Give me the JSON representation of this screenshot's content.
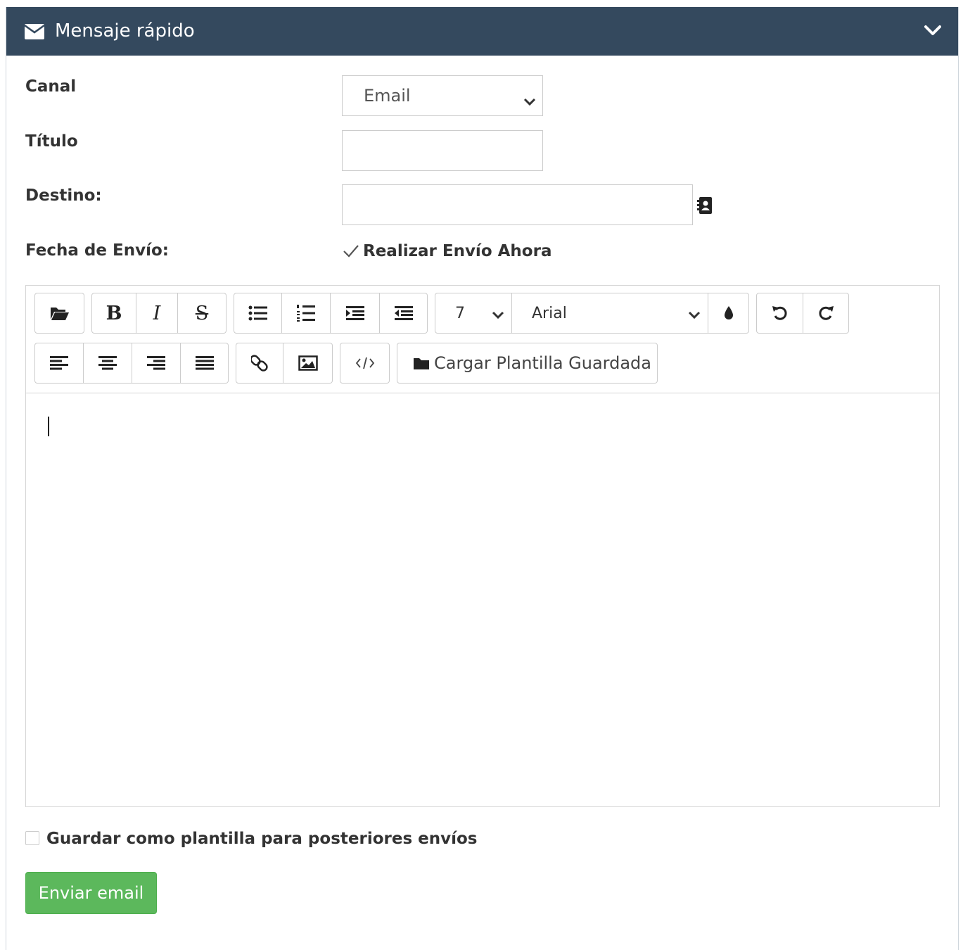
{
  "panel": {
    "title": "Mensaje rápido",
    "header_icon": "envelope-icon",
    "collapse_icon": "chevron-down-icon",
    "header_color": "#34495e"
  },
  "form": {
    "canal": {
      "label": "Canal",
      "value": "Email"
    },
    "titulo": {
      "label": "Título",
      "value": ""
    },
    "destino": {
      "label": "Destino:",
      "value": "",
      "icon": "address-book-icon"
    },
    "fecha": {
      "label": "Fecha de Envío:",
      "checkbox_label": "Realizar Envío Ahora",
      "checked": true
    }
  },
  "editor": {
    "toolbar": {
      "font_size": "7",
      "font_name": "Arial",
      "template_button": "Cargar Plantilla Guardada",
      "icons": [
        "folder-open-icon",
        "bold-icon",
        "italic-icon",
        "strikethrough-icon",
        "bullet-list-icon",
        "numbered-list-icon",
        "indent-icon",
        "outdent-icon",
        "font-color-icon",
        "undo-icon",
        "redo-icon",
        "align-left-icon",
        "align-center-icon",
        "align-right-icon",
        "align-justify-icon",
        "link-icon",
        "image-icon",
        "code-view-icon",
        "folder-icon"
      ],
      "bold_glyph": "B",
      "italic_glyph": "I",
      "strike_glyph": "S"
    },
    "content": ""
  },
  "footer": {
    "save_template_label": "Guardar como plantilla para posteriores envíos",
    "save_template_checked": false,
    "send_button": "Enviar email",
    "send_color": "#5cb85c"
  }
}
